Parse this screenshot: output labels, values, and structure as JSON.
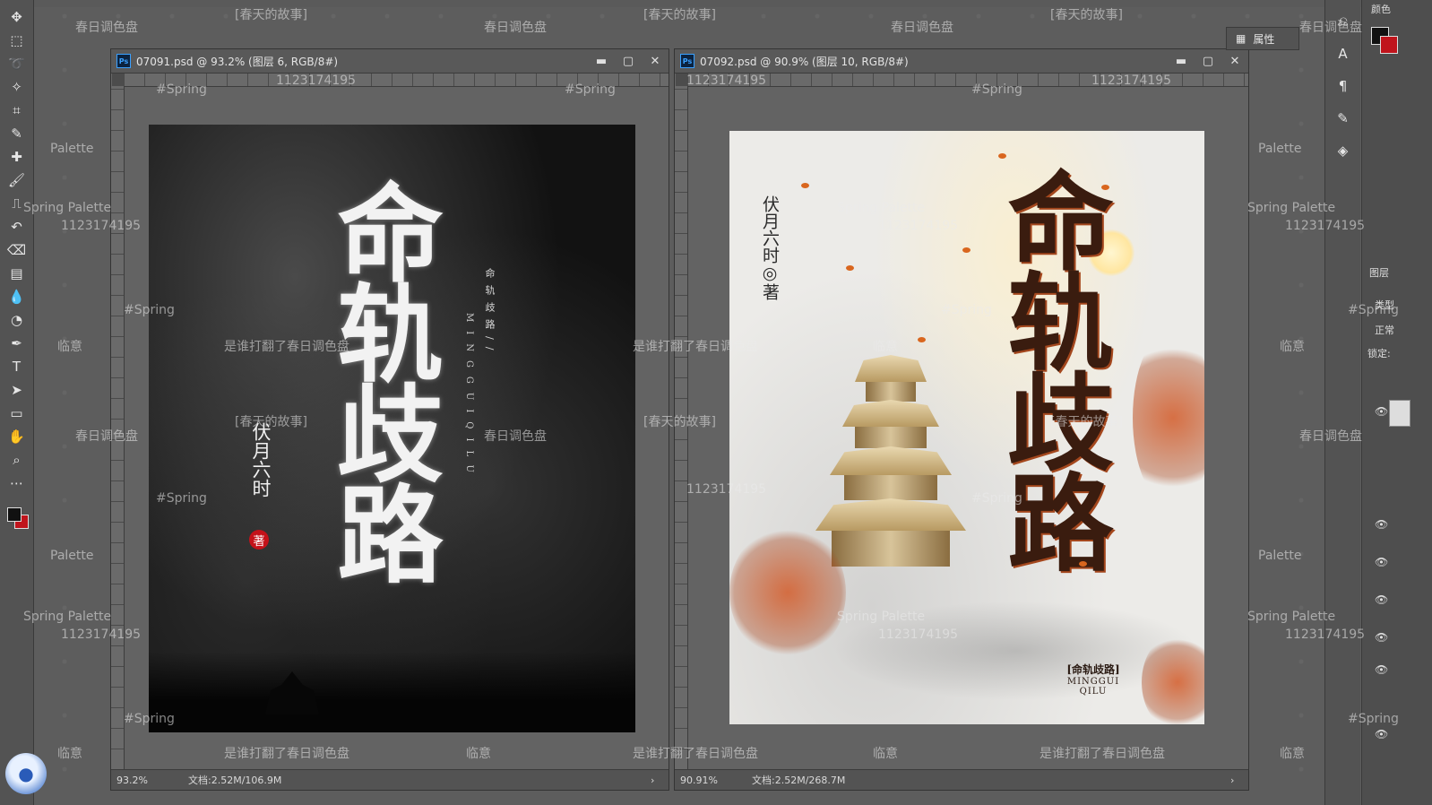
{
  "app": {
    "name": "Photoshop"
  },
  "toolbar": {
    "tools": [
      {
        "name": "move-tool",
        "glyph": "✥"
      },
      {
        "name": "marquee-tool",
        "glyph": "⬚"
      },
      {
        "name": "lasso-tool",
        "glyph": "➰"
      },
      {
        "name": "magic-wand-tool",
        "glyph": "✧"
      },
      {
        "name": "crop-tool",
        "glyph": "⌗"
      },
      {
        "name": "eyedropper-tool",
        "glyph": "✎"
      },
      {
        "name": "healing-brush-tool",
        "glyph": "✚"
      },
      {
        "name": "brush-tool",
        "glyph": "🖌"
      },
      {
        "name": "clone-stamp-tool",
        "glyph": "⎍"
      },
      {
        "name": "history-brush-tool",
        "glyph": "↶"
      },
      {
        "name": "eraser-tool",
        "glyph": "⌫"
      },
      {
        "name": "gradient-tool",
        "glyph": "▤"
      },
      {
        "name": "blur-tool",
        "glyph": "💧"
      },
      {
        "name": "dodge-tool",
        "glyph": "◔"
      },
      {
        "name": "pen-tool",
        "glyph": "✒"
      },
      {
        "name": "type-tool",
        "glyph": "T"
      },
      {
        "name": "path-selection-tool",
        "glyph": "➤"
      },
      {
        "name": "shape-tool",
        "glyph": "▭"
      },
      {
        "name": "hand-tool",
        "glyph": "✋"
      },
      {
        "name": "zoom-tool",
        "glyph": "⌕"
      },
      {
        "name": "more-tools",
        "glyph": "⋯"
      }
    ],
    "fg_color": "#111111",
    "bg_color": "#c0141c"
  },
  "documents": [
    {
      "title": "07091.psd @ 93.2% (图层 6, RGB/8#)",
      "zoom": "93.2%",
      "doc_size": "文档:2.52M/106.9M",
      "poster": {
        "title": "命轨歧路",
        "author": "伏月六时",
        "seal": "著",
        "sub_vertical": "命轨歧路//",
        "pinyin_vertical": "MINGGUIQILU"
      }
    },
    {
      "title": "07092.psd @ 90.9% (图层 10, RGB/8#)",
      "zoom": "90.91%",
      "doc_size": "文档:2.52M/268.7M",
      "poster": {
        "title": "命轨歧路",
        "author": "伏月六时◎著",
        "tag_cn": "[命轨歧路]",
        "tag_py1": "MINGGUI",
        "tag_py2": "QILU"
      }
    }
  ],
  "window_controls": {
    "minimize": "▬",
    "maximize": "▢",
    "close": "✕"
  },
  "watermarks": {
    "spring_story": "[春天的故事]",
    "spring_palette_cn": "春日调色盘",
    "hashtag": "#Spring",
    "id": "1123174195",
    "palette": "Palette",
    "spring_palette": "Spring Palette",
    "linyi": "临意",
    "who_opened": "是谁打翻了春日调色盘"
  },
  "right_panel": {
    "color_label": "颜色",
    "properties_label": "属性",
    "layers_label": "图层",
    "kind_label": "类型",
    "blend_mode": "正常",
    "lock_label": "锁定:"
  }
}
